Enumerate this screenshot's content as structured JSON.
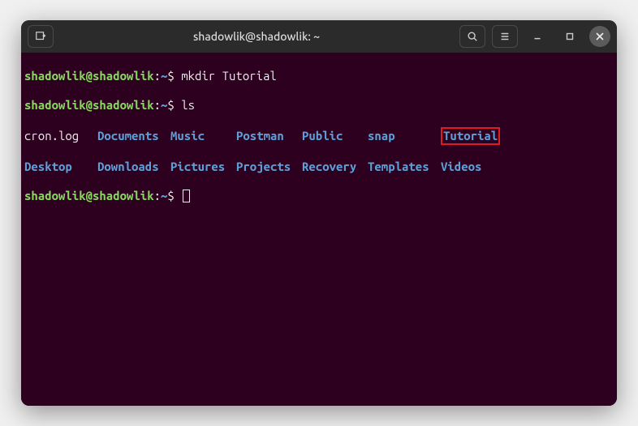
{
  "titlebar": {
    "title": "shadowlik@shadowlik: ~"
  },
  "prompt": {
    "user_host": "shadowlik@shadowlik",
    "colon": ":",
    "path": "~",
    "symbol": "$"
  },
  "commands": {
    "cmd1": "mkdir Tutorial",
    "cmd2": "ls"
  },
  "ls_output": {
    "row1": {
      "c1": "cron.log",
      "c2": "Documents",
      "c3": "Music",
      "c4": "Postman",
      "c5": "Public",
      "c6": "snap",
      "c7": "Tutorial"
    },
    "row2": {
      "c1": "Desktop",
      "c2": "Downloads",
      "c3": "Pictures",
      "c4": "Projects",
      "c5": "Recovery",
      "c6": "Templates",
      "c7": "Videos"
    }
  },
  "colors": {
    "background": "#2c001e",
    "titlebar": "#2b2b2b",
    "user_green": "#87d75f",
    "dir_blue": "#5f9fd7",
    "highlight_red": "#e01b24"
  }
}
